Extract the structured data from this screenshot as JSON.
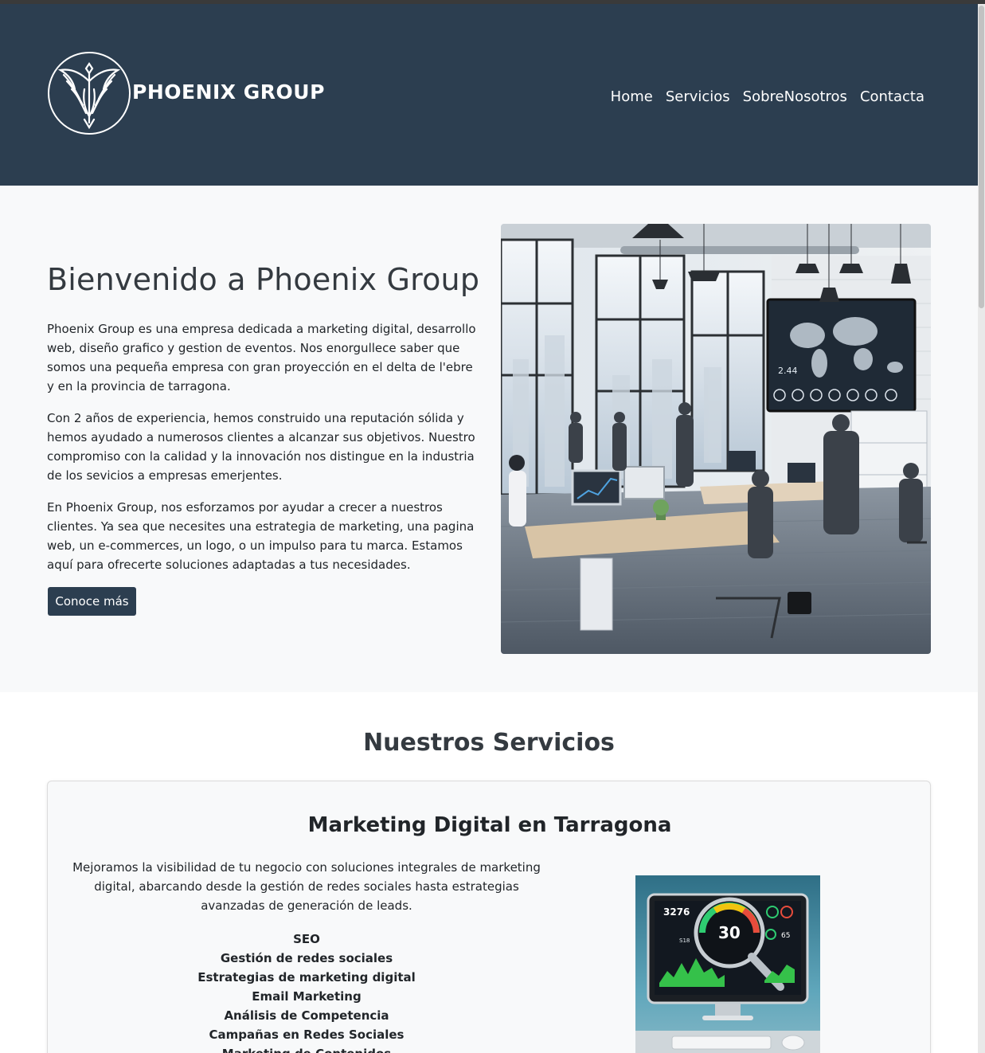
{
  "brand": {
    "name": "PHOENIX GROUP",
    "logo_icon": "phoenix-bird-icon"
  },
  "nav": {
    "items": [
      {
        "label": "Home"
      },
      {
        "label": "Servicios"
      },
      {
        "label": "SobreNosotros"
      },
      {
        "label": "Contacta"
      }
    ]
  },
  "hero": {
    "title": "Bienvenido a Phoenix Group",
    "paragraphs": [
      "Phoenix Group es una empresa dedicada a marketing digital, desarrollo web, diseño grafico y gestion de eventos. Nos enorgullece saber que somos una pequeña empresa con gran proyección en el delta de l'ebre y en la provincia de tarragona.",
      "Con 2 años de experiencia, hemos construido una reputación sólida y hemos ayudado a numerosos clientes a alcanzar sus objetivos. Nuestro compromiso con la calidad y la innovación nos distingue en la industria de los sevicios a empresas emerjentes.",
      "En Phoenix Group, nos esforzamos por ayudar a crecer a nuestros clientes. Ya sea que necesites una estrategia de marketing, una pagina web, un e-commerces, un logo, o un impulso para tu marca. Estamos aquí para ofrecerte soluciones adaptadas a tus necesidades."
    ],
    "button_label": "Conoce más"
  },
  "services": {
    "title": "Nuestros Servicios",
    "card": {
      "title": "Marketing Digital en Tarragona",
      "description": "Mejoramos la visibilidad de tu negocio con soluciones integrales de marketing digital, abarcando desde la gestión de redes sociales hasta estrategias avanzadas de generación de leads.",
      "items": [
        "SEO",
        "Gestión de redes sociales",
        "Estrategias de marketing digital",
        "Email Marketing",
        "Análisis de Competencia",
        "Campañas en Redes Sociales",
        "Marketing de Contenidos"
      ],
      "image": {
        "readout_left": "3276",
        "readout_center": "30",
        "readout_right": "65",
        "readout_small": "S18"
      }
    }
  },
  "office_image": {
    "screen_readout": "2.44"
  },
  "colors": {
    "header_bg": "#2c3e50",
    "hero_bg": "#f8f9fa",
    "button_bg": "#2c3e50"
  }
}
